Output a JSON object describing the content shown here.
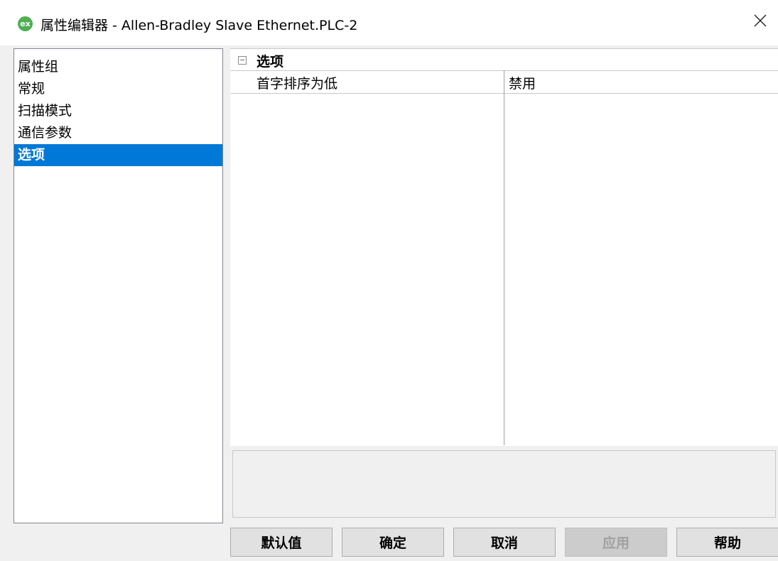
{
  "window": {
    "title": "属性编辑器 - Allen-Bradley Slave Ethernet.PLC-2",
    "app_icon_text": "ex"
  },
  "groups": {
    "header": "属性组",
    "items": [
      {
        "label": "常规",
        "selected": false
      },
      {
        "label": "扫描模式",
        "selected": false
      },
      {
        "label": "通信参数",
        "selected": false
      },
      {
        "label": "选项",
        "selected": true
      }
    ]
  },
  "properties": {
    "category": "选项",
    "collapse_glyph": "−",
    "rows": [
      {
        "name": "首字排序为低",
        "value": "禁用"
      }
    ]
  },
  "buttons": {
    "default": "默认值",
    "ok": "确定",
    "cancel": "取消",
    "apply": "应用",
    "help": "帮助"
  },
  "colors": {
    "selection": "#0078d7",
    "app_icon": "#4caf50"
  }
}
